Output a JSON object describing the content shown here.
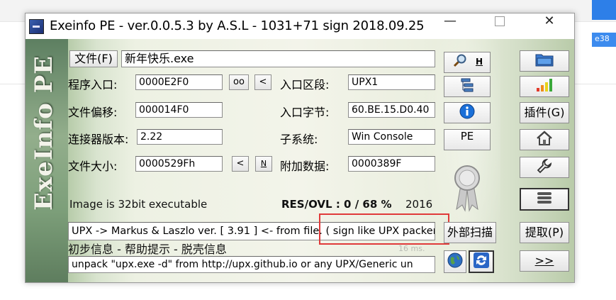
{
  "window": {
    "title": "Exeinfo PE - ver.0.0.5.3  by A.S.L -  1031+71 sign  2018.09.25",
    "minimize_glyph": "—",
    "close_glyph": "✕"
  },
  "branding": {
    "side_logo": "ExeInfo PE"
  },
  "file": {
    "button_label": "文件(F)",
    "name": "新年快乐.exe"
  },
  "fields": {
    "entry_point": {
      "label": "程序入口:",
      "value": "0000E2F0"
    },
    "file_offset": {
      "label": "文件偏移:",
      "value": "000014F0"
    },
    "linker_version": {
      "label": "连接器版本:",
      "value": "2.22"
    },
    "file_size": {
      "label": "文件大小:",
      "value": "0000529Fh"
    },
    "entry_section": {
      "label": "入口区段:",
      "value": "UPX1"
    },
    "entry_bytes": {
      "label": "入口字节:",
      "value": "60.BE.15.D0.40"
    },
    "subsystem": {
      "label": "子系统:",
      "value": "Win Console"
    },
    "overlay": {
      "label": "附加数据:",
      "value": "0000389F"
    }
  },
  "small_buttons": {
    "oo": "oo",
    "lt1": "<",
    "lt2": "<",
    "n": "N"
  },
  "info": {
    "image_type": "Image is 32bit executable",
    "res_ovl": "RES/OVL : 0 / 68 %",
    "year": "2016",
    "detection": "UPX -> Markus & Laszlo ver. [ 3.91 ] <- from file. ( sign like UPX packer",
    "hint_label": "初步信息 - 帮助提示 - 脱壳信息",
    "timing": "16 ms.",
    "unpack_hint": "unpack \"upx.exe -d\"  from  http://upx.github.io or any UPX/Generic un"
  },
  "toolbar": {
    "h_label": "H",
    "pe_label": "PE",
    "plugins_label": "插件(G)",
    "external_scan_label": "外部扫描",
    "extract_label": "提取(P)",
    "next_label": ">>"
  },
  "colors": {
    "highlight_red": "#e03a3a",
    "bar_red": "#e23a2a",
    "bar_orange": "#f08c1a",
    "bar_yellow": "#e8d21a",
    "bar_green": "#3aa83a",
    "info_blue": "#1a6fd8"
  },
  "icons": [
    "magnifier-icon",
    "folder-icon",
    "signal-bars-icon",
    "tree-icon",
    "info-icon",
    "home-icon",
    "wrench-icon",
    "hamburger-icon",
    "award-ribbon-icon",
    "globe-icon",
    "refresh-icon"
  ]
}
